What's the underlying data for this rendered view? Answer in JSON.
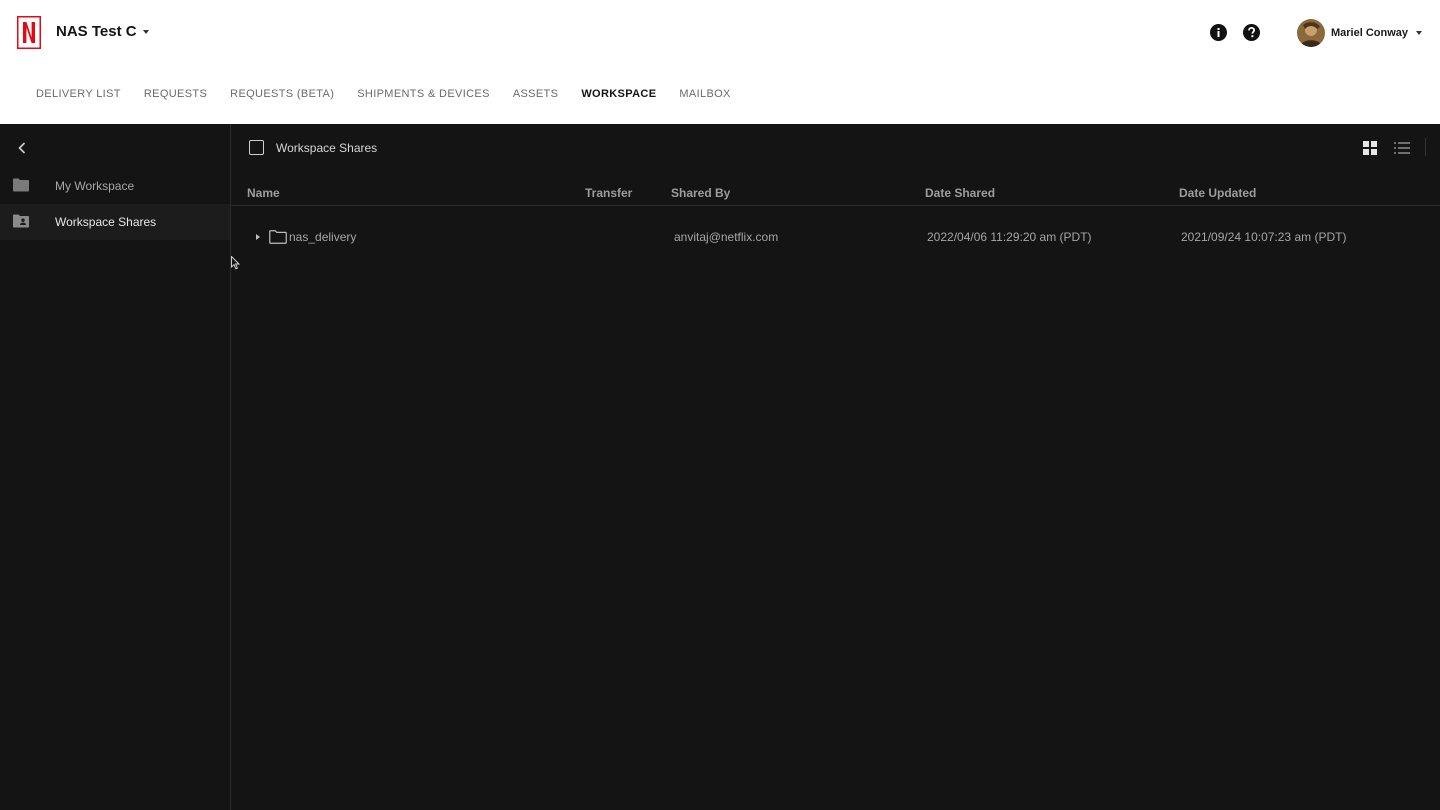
{
  "header": {
    "org_name": "NAS Test C",
    "user_name": "Mariel Conway",
    "nav": [
      {
        "label": "DELIVERY LIST"
      },
      {
        "label": "REQUESTS"
      },
      {
        "label": "REQUESTS (BETA)"
      },
      {
        "label": "SHIPMENTS & DEVICES"
      },
      {
        "label": "ASSETS"
      },
      {
        "label": "WORKSPACE"
      },
      {
        "label": "MAILBOX"
      }
    ],
    "active_nav": "WORKSPACE",
    "brand_color": "#E50914"
  },
  "sidebar": {
    "items": [
      {
        "label": "My Workspace",
        "icon": "folder-icon"
      },
      {
        "label": "Workspace Shares",
        "icon": "shared-folder-icon"
      }
    ],
    "active": "Workspace Shares"
  },
  "main": {
    "title": "Workspace Shares",
    "columns": {
      "name": "Name",
      "transfer": "Transfer",
      "shared_by": "Shared By",
      "date_shared": "Date Shared",
      "date_updated": "Date Updated"
    },
    "rows": [
      {
        "name": "nas_delivery",
        "transfer": "",
        "shared_by": "anvitaj@netflix.com",
        "date_shared": "2022/04/06 11:29:20 am (PDT)",
        "date_updated": "2021/09/24 10:07:23 am (PDT)"
      }
    ],
    "view_mode": "grid"
  }
}
